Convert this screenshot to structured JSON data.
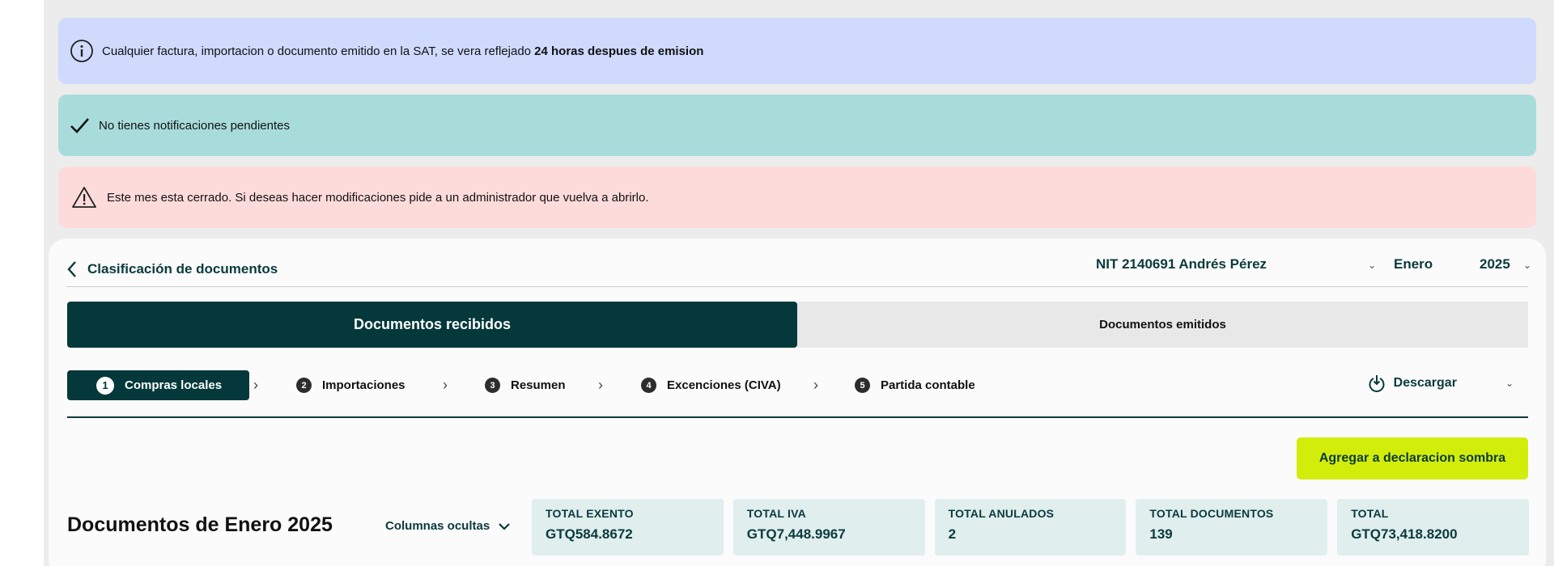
{
  "banners": {
    "info": {
      "text": "Cualquier factura, importacion o documento emitido en la SAT, se vera reflejado ",
      "bold": "24 horas despues de emision",
      "icon": "info-icon"
    },
    "ok": {
      "text": "No tienes notificaciones pendientes",
      "icon": "check-icon"
    },
    "warn": {
      "text": "Este mes esta cerrado. Si deseas hacer modificaciones pide a un administrador que vuelva a abrirlo.",
      "icon": "warning-icon"
    }
  },
  "header": {
    "back_label": "Clasificación de documentos",
    "entity": "NIT 2140691 Andrés Pérez",
    "month": "Enero",
    "year": "2025"
  },
  "tabs": {
    "received": "Documentos recibidos",
    "issued": "Documentos emitidos"
  },
  "steps": [
    {
      "num": "1",
      "label": "Compras locales"
    },
    {
      "num": "2",
      "label": "Importaciones"
    },
    {
      "num": "3",
      "label": "Resumen"
    },
    {
      "num": "4",
      "label": "Excenciones (CIVA)"
    },
    {
      "num": "5",
      "label": "Partida contable"
    }
  ],
  "download_label": "Descargar",
  "cta_label": "Agregar a declaracion sombra",
  "docs": {
    "title": "Documentos de Enero 2025",
    "hidden_columns": "Columnas ocultas"
  },
  "stats": [
    {
      "label": "TOTAL EXENTO",
      "value": "GTQ584.8672"
    },
    {
      "label": "TOTAL IVA",
      "value": "GTQ7,448.9967"
    },
    {
      "label": "TOTAL ANULADOS",
      "value": "2"
    },
    {
      "label": "TOTAL DOCUMENTOS",
      "value": "139"
    },
    {
      "label": "TOTAL",
      "value": "GTQ73,418.8200"
    }
  ],
  "colors": {
    "accent_dark": "#04383a",
    "cta": "#d2ed0a",
    "info_bg": "#cfdafd",
    "ok_bg": "#a8dcdb",
    "warn_bg": "#fddbdb"
  }
}
